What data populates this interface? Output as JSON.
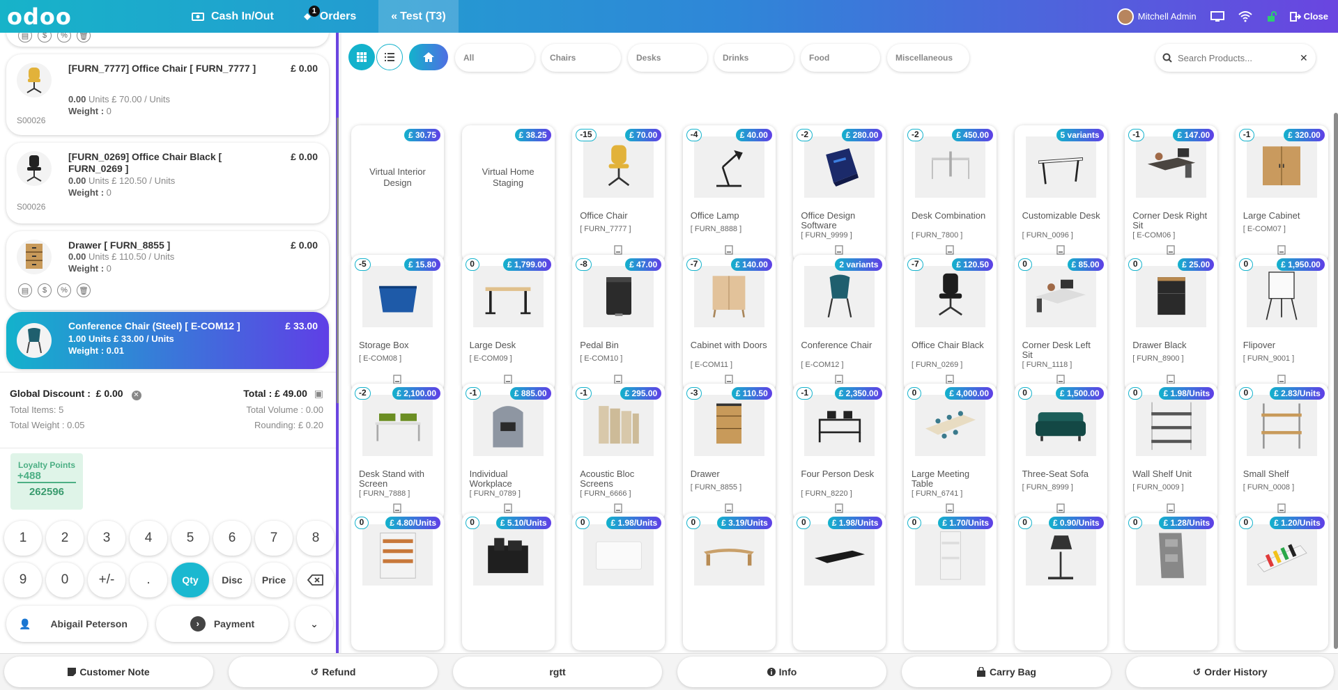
{
  "topbar": {
    "logo": "odoo",
    "cash": "Cash In/Out",
    "orders": "Orders",
    "orders_badge": "1",
    "table": "Test (T3)",
    "user": "Mitchell Admin",
    "close": "Close"
  },
  "order": {
    "lines": [
      {
        "name": "[FURN_7777] Office Chair [ FURN_7777 ]",
        "price": "£ 0.00",
        "qty": "0.00",
        "unit_text": "Units £ 70.00 / Units",
        "weight_label": "Weight :",
        "weight": "0",
        "ref": "S00026",
        "icon": "office-chair"
      },
      {
        "name": "[FURN_0269] Office Chair Black [ FURN_0269 ]",
        "price": "£ 0.00",
        "qty": "0.00",
        "unit_text": "Units £ 120.50 / Units",
        "weight_label": "Weight :",
        "weight": "0",
        "ref": "S00026",
        "icon": "office-chair-black"
      },
      {
        "name": "Drawer [ FURN_8855 ]",
        "price": "£ 0.00",
        "qty": "0.00",
        "unit_text": "Units £ 110.50 / Units",
        "weight_label": "Weight :",
        "weight": "0",
        "icon": "drawer"
      },
      {
        "name": "Conference Chair (Steel) [ E-COM12 ]",
        "price": "£ 33.00",
        "qty": "1.00",
        "unit_text": "Units £ 33.00 / Units",
        "weight_label": "Weight :",
        "weight": "0.01",
        "icon": "conference-chair"
      }
    ]
  },
  "summary": {
    "global_discount_label": "Global Discount :",
    "global_discount": "£ 0.00",
    "total_label": "Total :",
    "total": "£ 49.00",
    "total_items": "Total Items: 5",
    "total_volume": "Total Volume : 0.00",
    "total_weight": "Total Weight : 0.05",
    "rounding": "Rounding: £ 0.20"
  },
  "loyalty": {
    "title": "Loyalty Points",
    "points_added": "+488",
    "balance": "262596"
  },
  "numpad": {
    "keys": [
      "1",
      "2",
      "3",
      "4",
      "5",
      "6",
      "7",
      "8",
      "9",
      "0",
      "+/-",
      "."
    ],
    "qty": "Qty",
    "disc": "Disc",
    "price": "Price"
  },
  "actions": {
    "customer": "Abigail Peterson",
    "payment": "Payment"
  },
  "categories": [
    "All",
    "Chairs",
    "Desks",
    "Drinks",
    "Food",
    "Miscellaneous"
  ],
  "search": {
    "placeholder": "Search Products..."
  },
  "products": [
    {
      "name": "Virtual Interior Design",
      "price": "£ 30.75",
      "virtual": true
    },
    {
      "name": "Virtual Home Staging",
      "price": "£ 38.25",
      "virtual": true
    },
    {
      "name": "Office Chair",
      "ref": "[ FURN_7777 ]",
      "price": "£ 70.00",
      "qty": "-15",
      "icon": "office-chair"
    },
    {
      "name": "Office Lamp",
      "ref": "[ FURN_8888 ]",
      "price": "£ 40.00",
      "qty": "-4",
      "icon": "lamp"
    },
    {
      "name": "Office Design Software",
      "ref": "[ FURN_9999 ]",
      "price": "£ 280.00",
      "qty": "-2",
      "icon": "software-box"
    },
    {
      "name": "Desk Combination",
      "ref": "[ FURN_7800 ]",
      "price": "£ 450.00",
      "qty": "-2",
      "icon": "desk-combo"
    },
    {
      "name": "Customizable Desk",
      "ref": "[ FURN_0096 ]",
      "price": "5 variants",
      "icon": "desk"
    },
    {
      "name": "Corner Desk Right Sit",
      "ref": "[ E-COM06 ]",
      "price": "£ 147.00",
      "qty": "-1",
      "icon": "corner-desk"
    },
    {
      "name": "Large Cabinet",
      "ref": "[ E-COM07 ]",
      "price": "£ 320.00",
      "qty": "-1",
      "icon": "cabinet"
    },
    {
      "name": "Storage Box",
      "ref": "[ E-COM08 ]",
      "price": "£ 15.80",
      "qty": "-5",
      "icon": "storage-box"
    },
    {
      "name": "Large Desk",
      "ref": "[ E-COM09 ]",
      "price": "£ 1,799.00",
      "qty": "0",
      "icon": "large-desk"
    },
    {
      "name": "Pedal Bin",
      "ref": "[ E-COM10 ]",
      "price": "£ 47.00",
      "qty": "-8",
      "icon": "pedal-bin"
    },
    {
      "name": "Cabinet with Doors",
      "ref": "[ E-COM11 ]",
      "price": "£ 140.00",
      "qty": "-7",
      "icon": "cabinet-doors"
    },
    {
      "name": "Conference Chair",
      "ref": "[ E-COM12 ]",
      "price": "2 variants",
      "icon": "conference-chair"
    },
    {
      "name": "Office Chair Black",
      "ref": "[ FURN_0269 ]",
      "price": "£ 120.50",
      "qty": "-7",
      "icon": "office-chair-black"
    },
    {
      "name": "Corner Desk Left Sit",
      "ref": "[ FURN_1118 ]",
      "price": "£ 85.00",
      "qty": "0",
      "icon": "corner-desk-left"
    },
    {
      "name": "Drawer Black",
      "ref": "[ FURN_8900 ]",
      "price": "£ 25.00",
      "qty": "0",
      "icon": "drawer-black"
    },
    {
      "name": "Flipover",
      "ref": "[ FURN_9001 ]",
      "price": "£ 1,950.00",
      "qty": "0",
      "icon": "flipover"
    },
    {
      "name": "Desk Stand with Screen",
      "ref": "[ FURN_7888 ]",
      "price": "£ 2,100.00",
      "qty": "-2",
      "icon": "desk-stand"
    },
    {
      "name": "Individual Workplace",
      "ref": "[ FURN_0789 ]",
      "price": "£ 885.00",
      "qty": "-1",
      "icon": "workplace-pod"
    },
    {
      "name": "Acoustic Bloc Screens",
      "ref": "[ FURN_6666 ]",
      "price": "£ 295.00",
      "qty": "-1",
      "icon": "acoustic-screens"
    },
    {
      "name": "Drawer",
      "ref": "[ FURN_8855 ]",
      "price": "£ 110.50",
      "qty": "-3",
      "icon": "drawer"
    },
    {
      "name": "Four Person Desk",
      "ref": "[ FURN_8220 ]",
      "price": "£ 2,350.00",
      "qty": "-1",
      "icon": "four-person-desk"
    },
    {
      "name": "Large Meeting Table",
      "ref": "[ FURN_6741 ]",
      "price": "£ 4,000.00",
      "qty": "0",
      "icon": "meeting-table"
    },
    {
      "name": "Three-Seat Sofa",
      "ref": "[ FURN_8999 ]",
      "price": "£ 1,500.00",
      "qty": "0",
      "icon": "sofa"
    },
    {
      "name": "Wall Shelf Unit",
      "ref": "[ FURN_0009 ]",
      "price": "£ 1.98/Units",
      "qty": "0",
      "icon": "wall-shelf"
    },
    {
      "name": "Small Shelf",
      "ref": "[ FURN_0008 ]",
      "price": "£ 2.83/Units",
      "qty": "0",
      "icon": "small-shelf"
    },
    {
      "name": "",
      "price": "£ 4.80/Units",
      "qty": "0",
      "icon": "letter-tray"
    },
    {
      "name": "",
      "price": "£ 5.10/Units",
      "qty": "0",
      "icon": "desk-organizer"
    },
    {
      "name": "",
      "price": "£ 1.98/Units",
      "qty": "0",
      "icon": "whiteboard"
    },
    {
      "name": "",
      "price": "£ 3.19/Units",
      "qty": "0",
      "icon": "monitor-stand"
    },
    {
      "name": "",
      "price": "£ 1.98/Units",
      "qty": "0",
      "icon": "desk-pad"
    },
    {
      "name": "",
      "price": "£ 1.70/Units",
      "qty": "0",
      "icon": "wall-pockets"
    },
    {
      "name": "",
      "price": "£ 0.90/Units",
      "qty": "0",
      "icon": "desk-lamp"
    },
    {
      "name": "",
      "price": "£ 1.28/Units",
      "qty": "0",
      "icon": "magazine-holder"
    },
    {
      "name": "",
      "price": "£ 1.20/Units",
      "qty": "0",
      "icon": "markers"
    }
  ],
  "bottom": {
    "customer_note": "Customer Note",
    "refund": "Refund",
    "rgtt": "rgtt",
    "info": "Info",
    "carry_bag": "Carry Bag",
    "order_history": "Order History"
  },
  "colors": {
    "accent_start": "#13b2cc",
    "accent_end": "#5f3fe6",
    "loyalty_bg": "#dff4e8"
  }
}
